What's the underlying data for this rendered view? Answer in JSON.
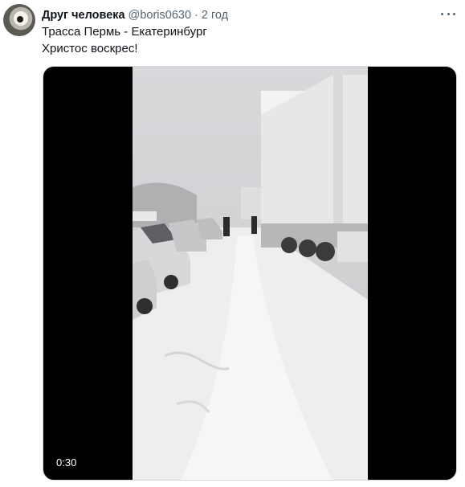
{
  "user": {
    "name": "Друг человека",
    "handle": "@boris0630",
    "separator": "·",
    "time": "2 год"
  },
  "tweet": {
    "lines": [
      "Трасса Пермь - Екатеринбург",
      "Христос воскрес!"
    ]
  },
  "media": {
    "type": "video",
    "duration": "0:30",
    "description_icon": "video-frame"
  },
  "icons": {
    "more": "more-options-icon"
  }
}
